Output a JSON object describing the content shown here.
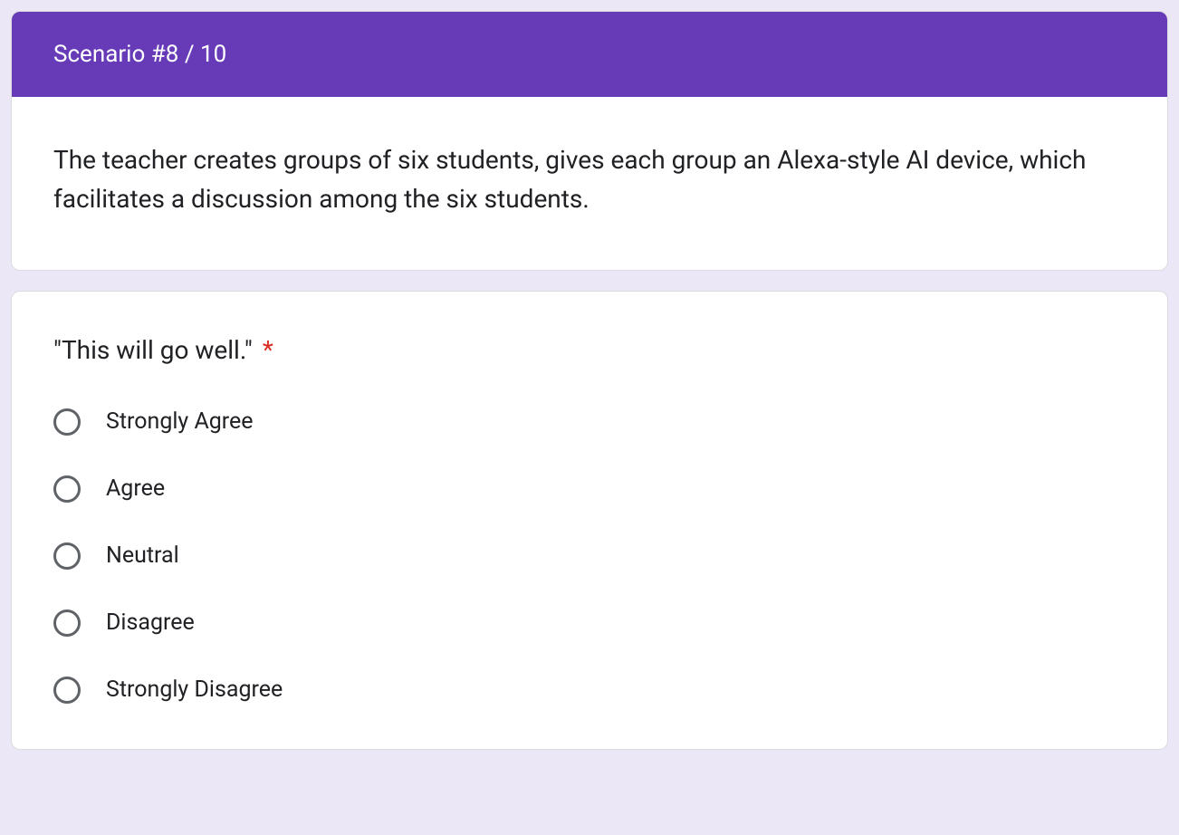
{
  "scenario": {
    "header": "Scenario #8 / 10",
    "description": "The teacher creates groups of six students, gives each group an Alexa-style AI device, which facilitates a discussion among the six students."
  },
  "question": {
    "title": "\"This will go well.\"",
    "required_marker": "*",
    "options": [
      "Strongly Agree",
      "Agree",
      "Neutral",
      "Disagree",
      "Strongly Disagree"
    ]
  }
}
